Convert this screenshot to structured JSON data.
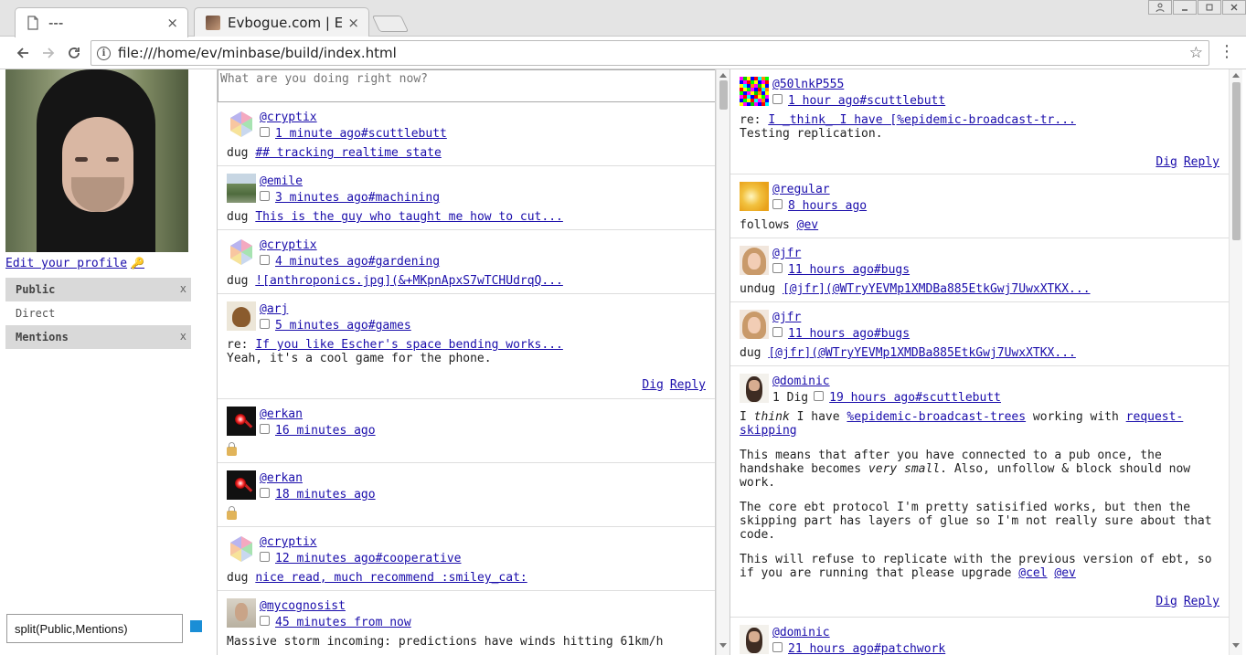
{
  "browser": {
    "tabs": [
      {
        "title": "---",
        "active": true
      },
      {
        "title": "Evbogue.com | Ev",
        "active": false
      }
    ],
    "tab_close_glyph": "×",
    "url": "file:///home/ev/minbase/build/index.html",
    "icons": {
      "back": "back-arrow-icon",
      "forward": "forward-arrow-icon",
      "reload": "reload-icon",
      "info": "info-icon",
      "star": "star-icon",
      "menu": "kebab-menu-icon"
    }
  },
  "sidebar": {
    "edit_profile": "Edit your profile",
    "feeds": [
      {
        "label": "Public",
        "active": true,
        "close": "x"
      },
      {
        "label": "Direct",
        "active": false,
        "close": ""
      },
      {
        "label": "Mentions",
        "active": true,
        "close": "x"
      }
    ],
    "split_value": "split(Public,Mentions)",
    "accent": "#1a8ed6"
  },
  "compose": {
    "placeholder": "What are you doing right now?"
  },
  "actions": {
    "dig": "Dig",
    "reply": "Reply"
  },
  "left_feed": [
    {
      "author": "@cryptix",
      "ts": "1 minute ago",
      "channel": "#scuttlebutt",
      "prefix": "dug",
      "link": "## tracking realtime state",
      "text": ""
    },
    {
      "author": "@emile",
      "ts": "3 minutes ago",
      "channel": "#machining",
      "prefix": "dug",
      "link": "This is the guy who taught me how to cut...",
      "text": ""
    },
    {
      "author": "@cryptix",
      "ts": "4 minutes ago",
      "channel": "#gardening",
      "prefix": "dug",
      "link": "![anthroponics.jpg](&+MKpnApxS7wTCHUdrqQ...",
      "text": ""
    },
    {
      "author": "@arj",
      "ts": "5 minutes ago",
      "channel": "#games",
      "prefix": "re:",
      "link": "If you like Escher's space bending works...",
      "text": "Yeah, it's a cool game for the phone."
    },
    {
      "author": "@erkan",
      "ts": "16 minutes ago",
      "channel": "",
      "prefix": "",
      "link": "",
      "text": ""
    },
    {
      "author": "@erkan",
      "ts": "18 minutes ago",
      "channel": "",
      "prefix": "",
      "link": "",
      "text": ""
    },
    {
      "author": "@cryptix",
      "ts": "12 minutes ago",
      "channel": "#cooperative",
      "prefix": "dug",
      "link": "nice read, much recommend :smiley_cat:",
      "text": ""
    },
    {
      "author": "@mycognosist",
      "ts": "45 minutes from now",
      "channel": "",
      "prefix": "",
      "link": "",
      "text": "Massive storm incoming: predictions have winds hitting 61km/h"
    }
  ],
  "right_feed": [
    {
      "author": "@50lnkP555",
      "ts": "1 hour ago",
      "channel": "#scuttlebutt",
      "prefix": "re:",
      "link": "I _think_ I have [%epidemic-broadcast-tr...",
      "text": "Testing replication."
    },
    {
      "author": "@regular",
      "ts": "8 hours ago",
      "channel": "",
      "prefix": "follows",
      "link": "@ev",
      "text": ""
    },
    {
      "author": "@jfr",
      "ts": "11 hours ago",
      "channel": "#bugs",
      "prefix": "undug",
      "link": "[@jfr](@WTryYEVMp1XMDBa885EtkGwj7UwxXTKX...",
      "text": ""
    },
    {
      "author": "@jfr",
      "ts": "11 hours ago",
      "channel": "#bugs",
      "prefix": "dug",
      "link": "[@jfr](@WTryYEVMp1XMDBa885EtkGwj7UwxXTKX...",
      "text": ""
    },
    {
      "author": "@dominic",
      "digs": "1 Dig",
      "ts": "19 hours ago",
      "channel": "#scuttlebutt",
      "p1_a": "I ",
      "p1_em": "think",
      "p1_b": " I have ",
      "p1_link1": "%epidemic-broadcast-trees",
      "p1_c": " working with ",
      "p1_link2": "request-skipping",
      "p2_a": "This means that after you have connected to a pub once, the handshake becomes ",
      "p2_em": "very small",
      "p2_b": ". Also, unfollow & block should now work.",
      "p3": "The core ebt protocol I'm pretty satisified works, but then the skipping part has layers of glue so I'm not really sure about that code.",
      "p4_a": "This will refuse to replicate with the previous version of ebt, so if you are running that please upgrade ",
      "p4_m1": "@cel",
      "p4_m2": "@ev"
    },
    {
      "author": "@dominic",
      "ts": "21 hours ago",
      "channel": "#patchwork"
    }
  ]
}
